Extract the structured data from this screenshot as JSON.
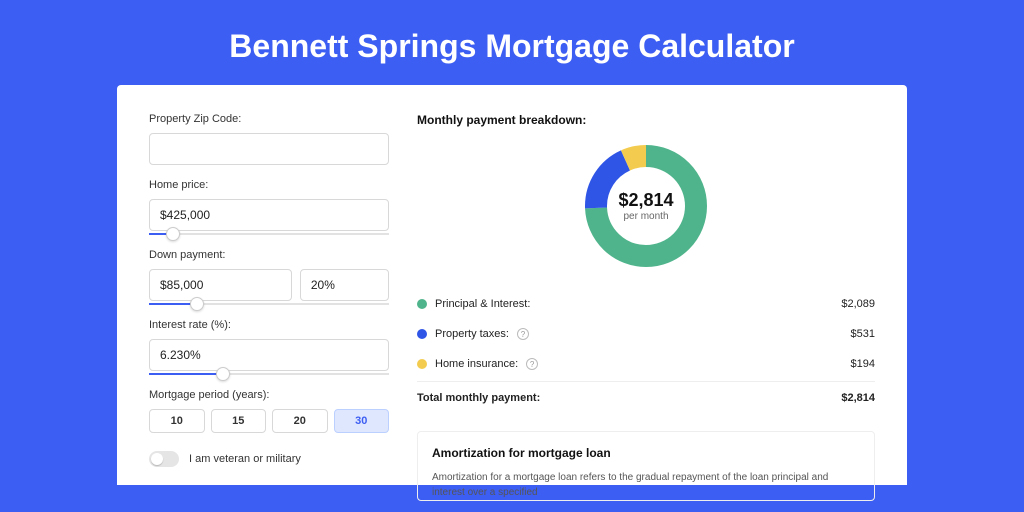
{
  "title": "Bennett Springs Mortgage Calculator",
  "left": {
    "zip_label": "Property Zip Code:",
    "zip_value": "",
    "home_price_label": "Home price:",
    "home_price_value": "$425,000",
    "home_price_slider_pct": 10,
    "down_payment_label": "Down payment:",
    "down_payment_value": "$85,000",
    "down_payment_pct": "20%",
    "down_payment_slider_pct": 20,
    "interest_label": "Interest rate (%):",
    "interest_value": "6.230%",
    "interest_slider_pct": 31,
    "period_label": "Mortgage period (years):",
    "periods": [
      "10",
      "15",
      "20",
      "30"
    ],
    "period_active": 3,
    "veteran_label": "I am veteran or military"
  },
  "right": {
    "breakdown_heading": "Monthly payment breakdown:",
    "total_amount": "$2,814",
    "total_sub": "per month",
    "items": [
      {
        "label": "Principal & Interest:",
        "value": "$2,089",
        "color": "#4fb48b",
        "info": false
      },
      {
        "label": "Property taxes:",
        "value": "$531",
        "color": "#2f55e6",
        "info": true
      },
      {
        "label": "Home insurance:",
        "value": "$194",
        "color": "#f3cc4f",
        "info": true
      }
    ],
    "total_label": "Total monthly payment:",
    "total_value": "$2,814",
    "amort_heading": "Amortization for mortgage loan",
    "amort_body": "Amortization for a mortgage loan refers to the gradual repayment of the loan principal and interest over a specified"
  },
  "chart_data": {
    "type": "pie",
    "title": "Monthly payment breakdown",
    "series": [
      {
        "name": "Principal & Interest",
        "value": 2089,
        "color": "#4fb48b"
      },
      {
        "name": "Property taxes",
        "value": 531,
        "color": "#2f55e6"
      },
      {
        "name": "Home insurance",
        "value": 194,
        "color": "#f3cc4f"
      }
    ],
    "total": 2814,
    "center_label": "$2,814",
    "center_sub": "per month"
  }
}
